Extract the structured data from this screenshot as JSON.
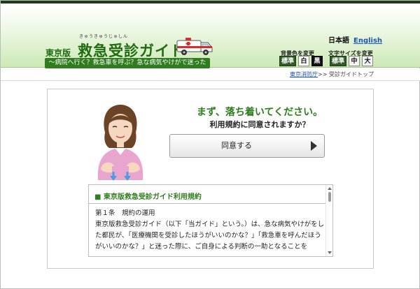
{
  "header": {
    "ruby": "きゅうきゅうじゅしん",
    "logo_sub": "東京版",
    "logo_main": "救急受診ガイド",
    "tagline": "〜病院へ行く？救急車を呼ぶ？急な病気やけがで迷ったら〜",
    "lang_ja": "日本語",
    "lang_en": "English",
    "bg_color_label": "背景色を変更",
    "bg_standard": "標準",
    "bg_white": "白",
    "bg_black": "黒",
    "font_size_label": "文字サイズを変更",
    "size_standard": "標準",
    "size_medium": "中",
    "size_large": "大"
  },
  "breadcrumb": {
    "link": "東京消防庁",
    "separator": ">>",
    "current": "受診ガイドトップ"
  },
  "main": {
    "headline": "まず、落ち着いてください。",
    "question": "利用規約に同意されますか？",
    "agree_label": "同意する"
  },
  "terms": {
    "heading": "■ 東京版救急受診ガイド利用規約",
    "lines": [
      "第１条　規約の運用",
      "東京版救急受診ガイド（以下「当ガイド」という。）は、急な病気やけがをした都民が、「医療機関を受診したほうがいいのかな？」「救急車を呼んだほうがいいのかな？」と迷った際に、ご自身による判断の一助となることを"
    ]
  },
  "colors": {
    "brand_green": "#2e7d1e",
    "link_blue": "#1a56b8"
  }
}
